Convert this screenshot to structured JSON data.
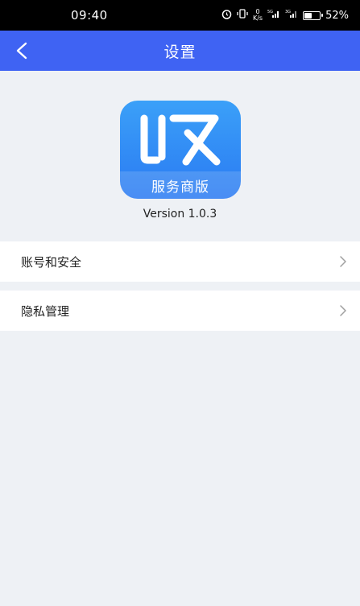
{
  "status_bar": {
    "time": "09:40",
    "speed_value": "0",
    "speed_unit": "K/s",
    "network_1": "5G",
    "network_2": "3G",
    "battery_text": "52%",
    "battery_level": 0.52
  },
  "nav": {
    "title": "设置"
  },
  "app": {
    "logo_banner": "服务商版",
    "version": "Version 1.0.3"
  },
  "settings": {
    "items": [
      {
        "label": "账号和安全"
      },
      {
        "label": "隐私管理"
      }
    ]
  },
  "colors": {
    "nav_bar": "#3f63f3",
    "page_background": "#eef1f5"
  }
}
